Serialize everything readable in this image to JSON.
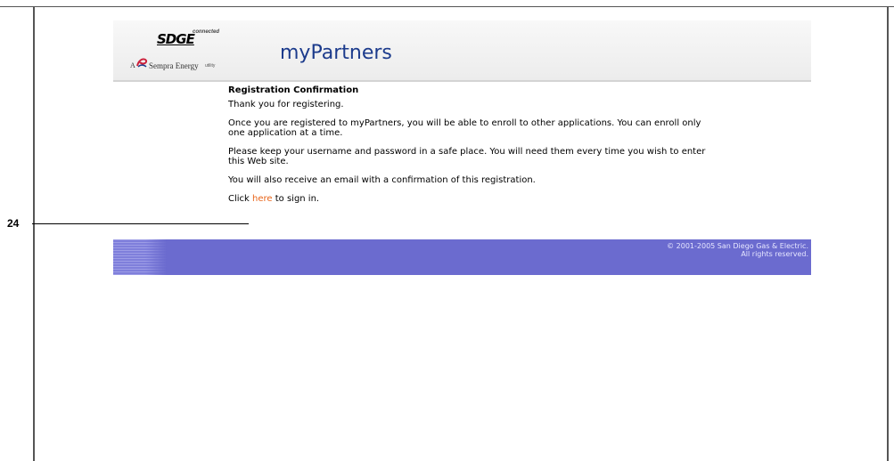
{
  "header": {
    "logo": {
      "brand": "SDGE",
      "tagline": "connected",
      "parent_prefix": "A",
      "parent": "Sempra Energy",
      "parent_suffix": "utility"
    },
    "app_title": "myPartners"
  },
  "content": {
    "heading": "Registration Confirmation",
    "paragraphs": [
      "Thank you for registering.",
      "Once you are registered to myPartners, you will be able to enroll to other applications. You can enroll only one application at a time.",
      "Please keep your username and password in a safe place. You will need them every time you wish to enter this Web site.",
      "You will also receive an email with a confirmation of this registration."
    ],
    "signin": {
      "prefix": "Click ",
      "link": "here",
      "suffix": " to sign in."
    }
  },
  "callout": {
    "number": "24"
  },
  "footer": {
    "copyright_line1": "© 2001-2005 San Diego Gas & Electric.",
    "copyright_line2": "All rights reserved."
  },
  "colors": {
    "title": "#1c3b8c",
    "link": "#e8651a",
    "footer": "#6b6bcf"
  },
  "icons": {
    "logo_mark": "sempra-swirl-icon"
  }
}
